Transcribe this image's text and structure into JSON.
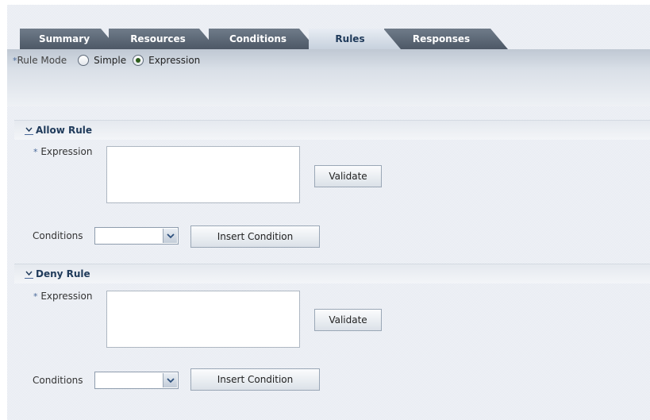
{
  "tabs": [
    {
      "label": "Summary",
      "active": false
    },
    {
      "label": "Resources",
      "active": false
    },
    {
      "label": "Conditions",
      "active": false
    },
    {
      "label": "Rules",
      "active": true
    },
    {
      "label": "Responses",
      "active": false
    }
  ],
  "rule_mode": {
    "required_marker": "*",
    "label": "Rule Mode",
    "options": [
      "Simple",
      "Expression"
    ],
    "selected": "Expression"
  },
  "allow_rule": {
    "title": "Allow Rule",
    "expression_required": "*",
    "expression_label": "Expression",
    "expression_value": "",
    "validate_label": "Validate",
    "conditions_label": "Conditions",
    "conditions_selected": "",
    "insert_label": "Insert Condition"
  },
  "deny_rule": {
    "title": "Deny Rule",
    "expression_required": "*",
    "expression_label": "Expression",
    "expression_value": "",
    "validate_label": "Validate",
    "conditions_label": "Conditions",
    "conditions_selected": "",
    "insert_label": "Insert Condition"
  },
  "colors": {
    "tab_inactive": "#4d5866",
    "tab_active": "#c7d1dd",
    "section_title": "#1f3a5a",
    "radio_selected": "#2d5d1c"
  },
  "icons": {
    "disclosure": "chevron-down-icon",
    "select_arrow": "chevron-down-icon"
  }
}
